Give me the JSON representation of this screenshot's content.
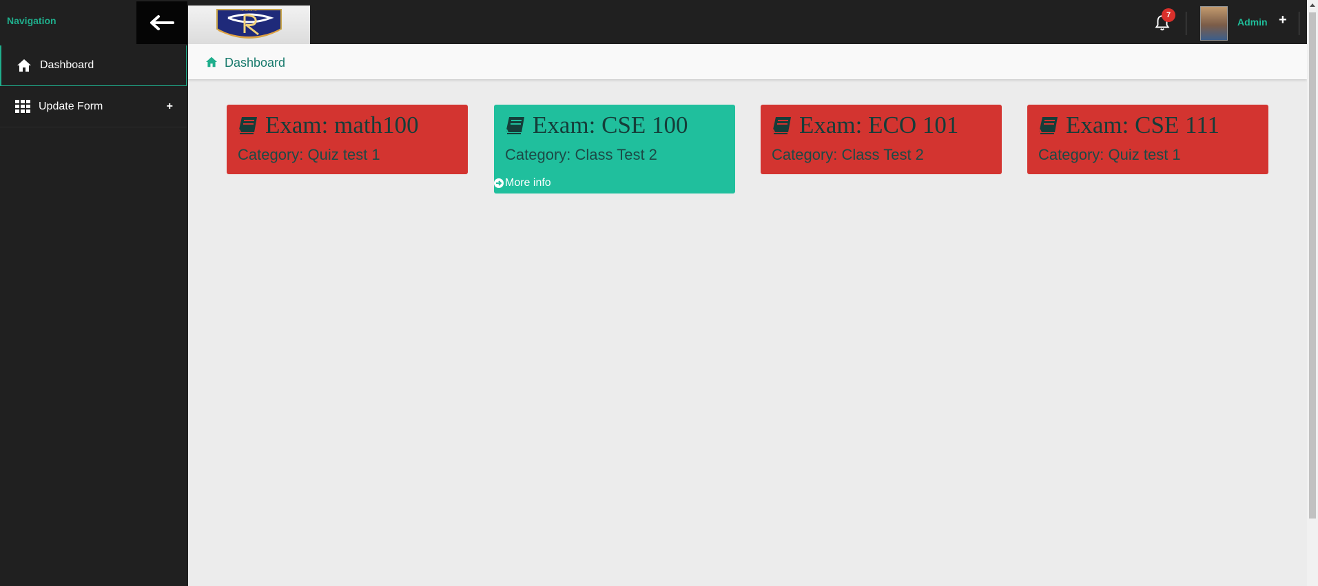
{
  "topbar": {
    "nav_label": "Navigation",
    "notifications_count": "7",
    "user_name": "Admin",
    "user_menu_plus": "+"
  },
  "sidebar": {
    "items": [
      {
        "label": "Dashboard",
        "icon": "home-icon",
        "active": true
      },
      {
        "label": "Update Form",
        "icon": "grid-icon",
        "expand": "+"
      }
    ]
  },
  "breadcrumb": {
    "label": "Dashboard",
    "icon": "home-icon"
  },
  "exams": [
    {
      "title": "Exam: math100",
      "category": "Category: Quiz test 1",
      "color": "#d33430"
    },
    {
      "title": "Exam: CSE 100",
      "category": "Category: Class Test 2",
      "color": "#20bf9d",
      "more": "More info"
    },
    {
      "title": "Exam: ECO 101",
      "category": "Category: Class Test 2",
      "color": "#d33430"
    },
    {
      "title": "Exam: CSE 111",
      "category": "Category: Quiz test 1",
      "color": "#d33430"
    }
  ],
  "colors": {
    "accent": "#1fae8c",
    "topbar": "#202020",
    "danger": "#d33430",
    "success": "#20bf9d"
  }
}
